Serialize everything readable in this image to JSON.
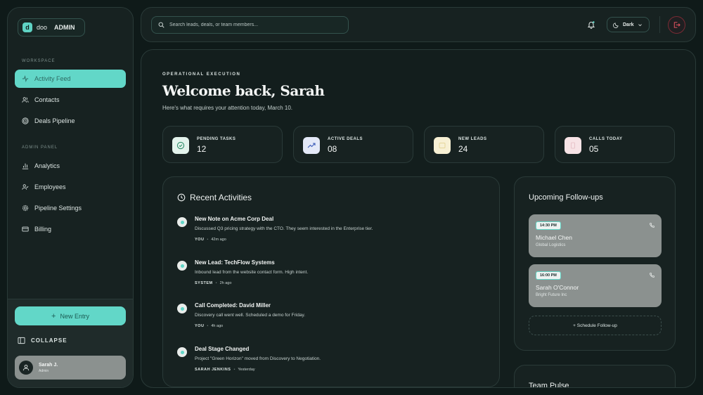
{
  "brand": {
    "logo_letter": "d",
    "name": "doo",
    "role": "ADMIN"
  },
  "sidebar": {
    "workspace_label": "WORKSPACE",
    "workspace_items": [
      {
        "label": "Activity Feed",
        "icon": "activity-icon",
        "active": true
      },
      {
        "label": "Contacts",
        "icon": "users-icon"
      },
      {
        "label": "Deals Pipeline",
        "icon": "target-icon"
      }
    ],
    "admin_label": "ADMIN PANEL",
    "admin_items": [
      {
        "label": "Analytics",
        "icon": "bar-chart-icon"
      },
      {
        "label": "Employees",
        "icon": "user-check-icon"
      },
      {
        "label": "Pipeline Settings",
        "icon": "gear-icon"
      },
      {
        "label": "Billing",
        "icon": "credit-card-icon"
      }
    ],
    "new_entry_label": "New Entry",
    "collapse_label": "COLLAPSE",
    "user": {
      "name": "Sarah J.",
      "role": "Admin"
    }
  },
  "topbar": {
    "search_placeholder": "Search leads, deals, or team members...",
    "theme_label": "Dark"
  },
  "main": {
    "eyebrow": "OPERATIONAL EXECUTION",
    "welcome": "Welcome back, Sarah",
    "subline": "Here's what requires your attention today, March 10.",
    "stats": [
      {
        "label": "PENDING TASKS",
        "value": "12",
        "icon": "check-circle-icon",
        "color": "#e3f3ec"
      },
      {
        "label": "ACTIVE DEALS",
        "value": "08",
        "icon": "trend-up-icon",
        "color": "#e4e9f8"
      },
      {
        "label": "NEW LEADS",
        "value": "24",
        "icon": "inbox-icon",
        "color": "#f7f0d4"
      },
      {
        "label": "CALLS TODAY",
        "value": "05",
        "icon": "phone-icon",
        "color": "#f7e3e6"
      }
    ]
  },
  "activities": {
    "title": "Recent Activities",
    "items": [
      {
        "title": "New Note on Acme Corp Deal",
        "desc": "Discussed Q3 pricing strategy with the CTO. They seem interested in the Enterprise tier.",
        "who": "YOU",
        "when": "42m ago"
      },
      {
        "title": "New Lead: TechFlow Systems",
        "desc": "Inbound lead from the website contact form. High intent.",
        "who": "SYSTEM",
        "when": "2h ago"
      },
      {
        "title": "Call Completed: David Miller",
        "desc": "Discovery call went well. Scheduled a demo for Friday.",
        "who": "YOU",
        "when": "4h ago"
      },
      {
        "title": "Deal Stage Changed",
        "desc": "Project \"Green Horizon\" moved from Discovery to Negotiation.",
        "who": "SARAH JENKINS",
        "when": "Yesterday"
      }
    ]
  },
  "followups": {
    "title": "Upcoming Follow-ups",
    "items": [
      {
        "time": "14:30 PM",
        "name": "Michael Chen",
        "company": "Global Logistics"
      },
      {
        "time": "16:00 PM",
        "name": "Sarah O'Connor",
        "company": "Bright Future Inc"
      }
    ],
    "schedule_label": "+ Schedule Follow-up"
  },
  "team_pulse": {
    "title": "Team Pulse"
  }
}
